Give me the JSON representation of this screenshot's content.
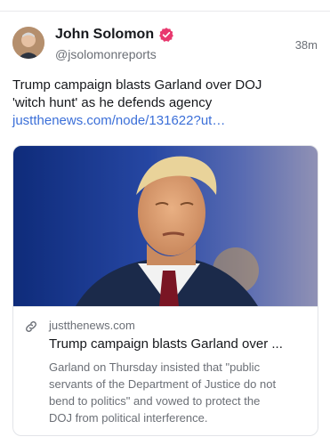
{
  "post": {
    "author_name": "John Solomon",
    "handle": "@jsolomonreports",
    "timestamp": "38m",
    "text_lines": [
      "Trump campaign blasts Garland over DOJ",
      "'witch hunt' as he defends agency"
    ],
    "link_text": "justthenews.com/node/131622?ut…",
    "verified_badge_color": "#e8386e",
    "link_color": "#3b6fd8"
  },
  "card": {
    "domain": "justthenews.com",
    "title": "Trump campaign blasts Garland over ...",
    "description_lines": [
      "Garland on Thursday insisted that \"public",
      "servants of the Department of Justice do not",
      "bend to politics\" and vowed to protect the",
      "DOJ from political interference."
    ],
    "icons": {
      "domain": "link-icon"
    }
  }
}
